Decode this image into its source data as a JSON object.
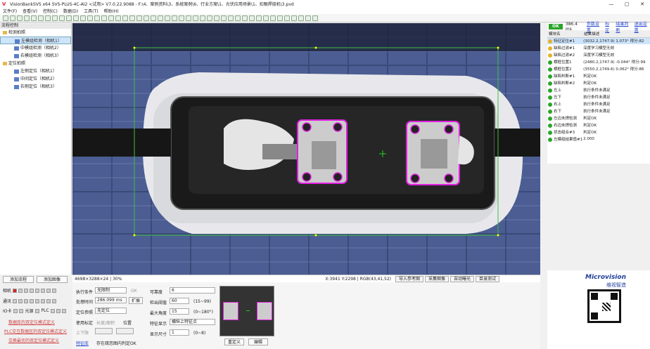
{
  "titlebar": {
    "title": "VisionBankSVS x64 SVS-PLUS-4C-AI2 <试用> V7.0.22.9088 - F:\\4、案例资料\\3、系统案例\\6、行业方案\\1、光伏应用场景\\1、扣眼焊接机\\3.pvd",
    "logo": "V",
    "minimize": "—",
    "maximize": "▢",
    "close": "✕"
  },
  "menu": [
    "文件(F)",
    "查看(V)",
    "控制(C)",
    "数据(D)",
    "工具(T)",
    "帮助(H)"
  ],
  "left": {
    "header": "流程控制",
    "tree": [
      {
        "label": "检测拍照",
        "level": 0,
        "kind": "folder"
      },
      {
        "label": "左模组检测（相机1）",
        "level": 1,
        "kind": "cam",
        "selected": true
      },
      {
        "label": "中模组检测（相机2）",
        "level": 1,
        "kind": "cam"
      },
      {
        "label": "右模组检测（相机3）",
        "level": 1,
        "kind": "cam"
      },
      {
        "label": "定位拍照",
        "level": 0,
        "kind": "folder"
      },
      {
        "label": "左侧定位（相机1）",
        "level": 1,
        "kind": "cam"
      },
      {
        "label": "中间定位（相机2）",
        "level": 1,
        "kind": "cam"
      },
      {
        "label": "右侧定位（相机3）",
        "level": 1,
        "kind": "cam"
      }
    ],
    "add_flow": "添加流程",
    "add_image": "添加图像",
    "leds": {
      "camera": "相机",
      "comm": "通讯",
      "io": "IO卡",
      "light": "光源",
      "plc": "PLC"
    },
    "links": [
      "数据库的双定位模式定义",
      "PLC交互数据区的双定位模式定义",
      "交换最优的双定位模式定义"
    ]
  },
  "status": {
    "imginfo": "4698×3288×24 | 30%",
    "coords": "X:3941 Y:2298 | RGB(43,41,52)",
    "buttons": [
      "导入参考图",
      "采集图像",
      "自动曝光",
      "目录测试"
    ]
  },
  "params": {
    "exec_cond_label": "执行条件",
    "exec_cond_value": "无限制",
    "ok_label": "OK",
    "proc_time_label": "处理时间",
    "proc_time_value": "286.099 ms",
    "expand": "扩展",
    "locref_label": "定位参照",
    "locref_value": "无定位",
    "use_cal_label": "使用标定",
    "long_area": "长度/面积",
    "position": "位置",
    "lower_label": "上下限",
    "feature": "特征库",
    "save_img": "存在疏忽图内判定OK",
    "score_label": "可靠度",
    "score_value": "6",
    "threshold_label": "检出阈值",
    "threshold_value": "60",
    "threshold_range": "(15~99)",
    "angle_label": "最大角度",
    "angle_value": "15",
    "angle_range": "(0~180°)",
    "feat_label": "特征显示",
    "feat_value": "横纵上特征点",
    "size_label": "显示尺寸",
    "size_value": "1",
    "size_range": "(0~8)",
    "redefine": "重定义",
    "edit": "编辑"
  },
  "right": {
    "status": "OK",
    "time": "386.4 ms",
    "links": [
      "参数设置",
      "标定",
      "结果判断",
      "退出设置"
    ],
    "col1": "模块名",
    "col2": "结果描述",
    "rows": [
      {
        "name": "特征定位#1",
        "desc": "(3032.2,1747.9) 1.073° 得分:82",
        "warn": true,
        "hl": true
      },
      {
        "name": "缺陷过滤#1",
        "desc": "深度学习模型无效",
        "warn": true
      },
      {
        "name": "缺陷过滤#2",
        "desc": "深度学习模型无效",
        "warn": true
      },
      {
        "name": "横框位置1",
        "desc": "(2480.2,1747.9) -0.044° 得分:99"
      },
      {
        "name": "横框位置2",
        "desc": "(3550.2,1749.6) 0.062° 得分:86"
      },
      {
        "name": "缺陷判断#1",
        "desc": "判定OK"
      },
      {
        "name": "缺陷判断#2",
        "desc": "判定OK"
      },
      {
        "name": "左上",
        "desc": "执行条件未满足"
      },
      {
        "name": "左下",
        "desc": "执行条件未满足"
      },
      {
        "name": "右上",
        "desc": "执行条件未满足"
      },
      {
        "name": "右下",
        "desc": "执行条件未满足"
      },
      {
        "name": "左边未焊检测",
        "desc": "判定OK"
      },
      {
        "name": "右边未焊检测",
        "desc": "判定OK"
      },
      {
        "name": "状态组合#3",
        "desc": "判定OK"
      },
      {
        "name": "左模组结果值#1",
        "desc": "2.000"
      }
    ]
  },
  "brand": {
    "name": "Microvision",
    "cn": "维视智造"
  }
}
